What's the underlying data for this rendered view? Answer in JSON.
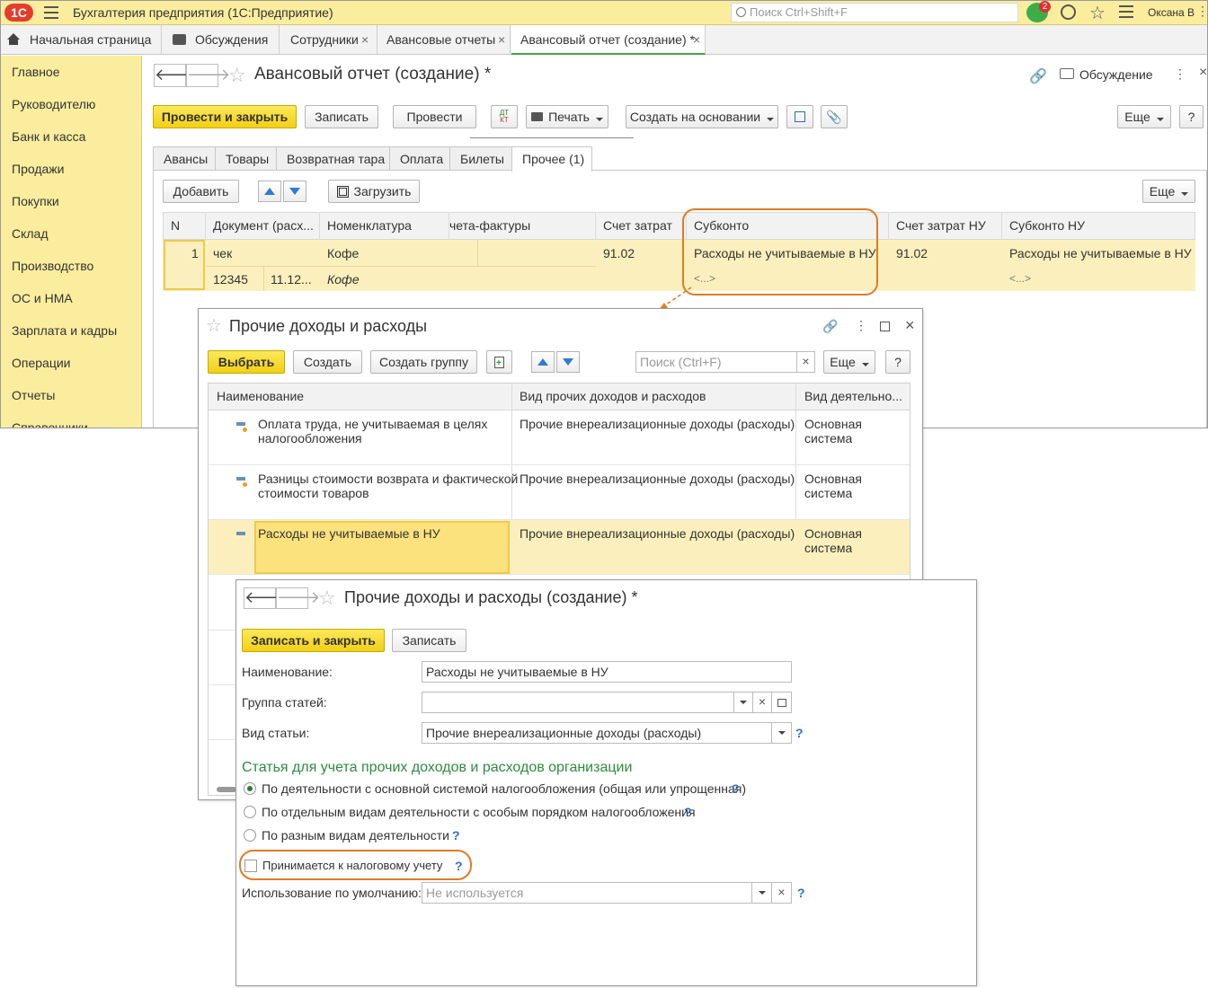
{
  "app": {
    "logo": "1С",
    "title": "Бухгалтерия предприятия (1С:Предприятие)",
    "search_placeholder": "Поиск Ctrl+Shift+F",
    "notification_count": "2",
    "user": "Оксана В"
  },
  "tabs": [
    {
      "label": "Начальная страница"
    },
    {
      "label": "Обсуждения"
    },
    {
      "label": "Сотрудники"
    },
    {
      "label": "Авансовые отчеты"
    },
    {
      "label": "Авансовый отчет (создание) *"
    }
  ],
  "sidebar": [
    "Главное",
    "Руководителю",
    "Банк и касса",
    "Продажи",
    "Покупки",
    "Склад",
    "Производство",
    "ОС и НМА",
    "Зарплата и кадры",
    "Операции",
    "Отчеты",
    "Справочники"
  ],
  "doc": {
    "title": "Авансовый отчет (создание) *",
    "discussion": "Обсуждение",
    "toolbar": {
      "post_close": "Провести и закрыть",
      "save": "Записать",
      "post": "Провести",
      "dtkt_top": "ДТ",
      "dtkt_bottom": "КТ",
      "print": "Печать",
      "create_based": "Создать на основании",
      "more": "Еще",
      "help": "?"
    },
    "subtabs": [
      "Авансы",
      "Товары",
      "Возвратная тара",
      "Оплата",
      "Билеты",
      "Прочее (1)"
    ],
    "table_toolbar": {
      "add": "Добавить",
      "load": "Загрузить",
      "more": "Еще"
    },
    "columns": [
      "N",
      "Документ (расх...",
      "Номенклатура",
      "чета-фактуры",
      "Счет затрат",
      "Субконто",
      "Счет затрат НУ",
      "Субконто НУ"
    ],
    "row": {
      "n": "1",
      "doc": "чек",
      "doc_num": "12345",
      "doc_date": "11.12...",
      "nomenclature": "Кофе",
      "nomenclature2": "Кофе",
      "account": "91.02",
      "subconto": "Расходы не учитываемые в НУ",
      "subconto2": "<...>",
      "account_nu": "91.02",
      "subconto_nu": "Расходы не учитываемые в НУ",
      "subconto_nu2": "<...>"
    }
  },
  "list": {
    "title": "Прочие доходы и расходы",
    "toolbar": {
      "select": "Выбрать",
      "create": "Создать",
      "create_group": "Создать группу",
      "search_placeholder": "Поиск (Ctrl+F)",
      "clear": "×",
      "more": "Еще",
      "help": "?"
    },
    "columns": [
      "Наименование",
      "Вид прочих доходов и расходов",
      "Вид деятельно..."
    ],
    "rows": [
      {
        "name1": "Оплата труда, не учитываемая в целях",
        "name2": "налогообложения",
        "kind": "Прочие внереализационные доходы (расходы)",
        "act1": "Основная",
        "act2": "система"
      },
      {
        "name1": "Разницы стоимости возврата и фактической",
        "name2": "стоимости товаров",
        "kind": "Прочие внереализационные доходы (расходы)",
        "act1": "Основная",
        "act2": "система"
      },
      {
        "name1": "Расходы не учитываемые в НУ",
        "name2": "",
        "kind": "Прочие внереализационные доходы (расходы)",
        "act1": "Основная",
        "act2": "система"
      }
    ]
  },
  "form": {
    "title": "Прочие доходы и расходы (создание) *",
    "toolbar": {
      "save_close": "Записать и закрыть",
      "save": "Записать"
    },
    "name_label": "Наименование:",
    "name_value": "Расходы не учитываемые в НУ",
    "group_label": "Группа статей:",
    "group_value": "",
    "kind_label": "Вид статьи:",
    "kind_value": "Прочие внереализационные доходы (расходы)",
    "section_title": "Статья для учета прочих доходов и расходов организации",
    "radios": [
      "По деятельности с основной системой налогообложения (общая или упрощенная)",
      "По отдельным видам деятельности с особым порядком налогообложения",
      "По разным видам деятельности"
    ],
    "checkbox_label": "Принимается к налоговому учету",
    "default_label": "Использование по умолчанию:",
    "default_value": "Не используется",
    "help": "?"
  },
  "colors": {
    "accent_yellow": "#f5d517",
    "sidebar_bg": "#fbed9e",
    "selection": "#fbf0bd",
    "orange_highlight": "#e07b24",
    "section_green": "#2e8b3e"
  }
}
